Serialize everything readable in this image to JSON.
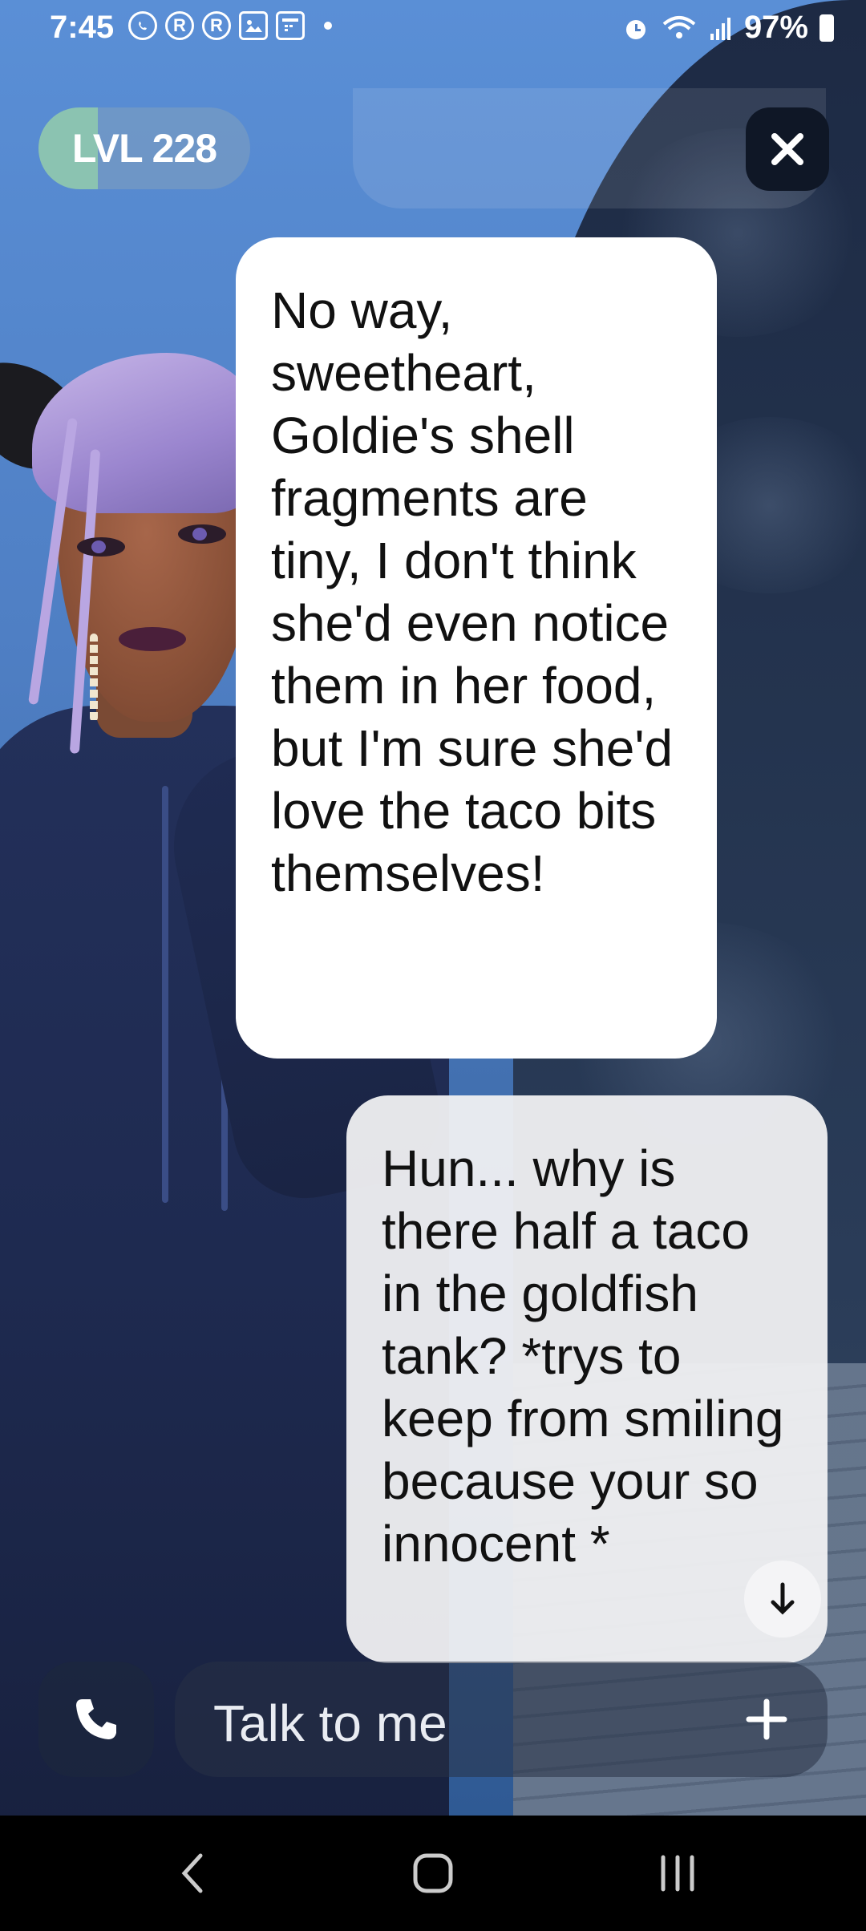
{
  "status_bar": {
    "time": "7:45",
    "notification_icons": [
      "whatsapp-icon",
      "r-app-icon",
      "r-app-icon",
      "gallery-icon",
      "calendar-icon"
    ],
    "r_label": "R",
    "battery": "97%"
  },
  "header": {
    "level_label": "LVL 228"
  },
  "messages": [
    {
      "sender": "bot",
      "text": "No way, sweetheart, Goldie's shell fragments are tiny, I don't think she'd even notice them in her food, but I'm sure she'd love the taco bits themselves!"
    },
    {
      "sender": "user",
      "text": "Hun... why is there half a taco in the goldfish tank? *trys to keep from smiling because your so innocent *"
    }
  ],
  "composer": {
    "placeholder": "Talk to me"
  },
  "colors": {
    "sky": "#5a8fd6",
    "bubble_bot": "#ffffff",
    "bubble_user": "#f0f0f2",
    "level_accent": "#96d2aa",
    "close_bg": "#0f1726"
  }
}
